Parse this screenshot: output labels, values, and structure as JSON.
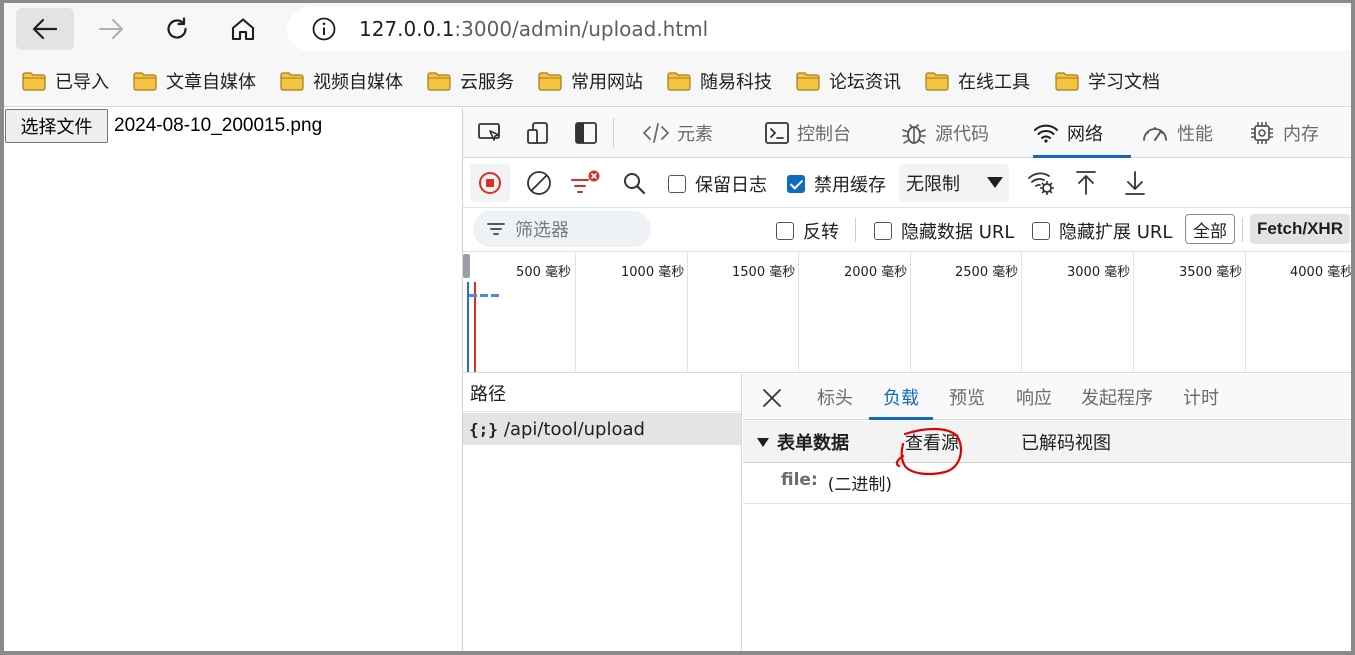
{
  "browser": {
    "address": {
      "host": "127.0.0.1",
      "rest": ":3000/admin/upload.html"
    },
    "bookmarks": [
      "已导入",
      "文章自媒体",
      "视频自媒体",
      "云服务",
      "常用网站",
      "随易科技",
      "论坛资讯",
      "在线工具",
      "学习文档"
    ]
  },
  "page": {
    "file_button_label": "选择文件",
    "file_name": "2024-08-10_200015.png"
  },
  "devtools": {
    "tabs": [
      "元素",
      "控制台",
      "源代码",
      "网络",
      "性能",
      "内存"
    ],
    "active_tab": "网络",
    "toolbar": {
      "preserve_log_label": "保留日志",
      "preserve_log_checked": false,
      "disable_cache_label": "禁用缓存",
      "disable_cache_checked": true,
      "throttle_value": "无限制"
    },
    "filter": {
      "placeholder": "筛选器",
      "invert_label": "反转",
      "hide_data_url_label": "隐藏数据 URL",
      "hide_ext_url_label": "隐藏扩展 URL",
      "all_label": "全部",
      "fetch_xhr_label": "Fetch/XHR"
    },
    "timeline_labels": [
      "500 毫秒",
      "1000 毫秒",
      "1500 毫秒",
      "2000 毫秒",
      "2500 毫秒",
      "3000 毫秒",
      "3500 毫秒",
      "4000 毫秒"
    ],
    "requests": {
      "column_header": "路径",
      "rows": [
        {
          "icon": "{;}",
          "path": "/api/tool/upload"
        }
      ]
    },
    "detail": {
      "tabs": [
        "标头",
        "负载",
        "预览",
        "响应",
        "发起程序",
        "计时"
      ],
      "active_tab": "负载",
      "section_title": "表单数据",
      "view_source": "查看源",
      "view_decoded": "已解码视图",
      "field_key": "file:",
      "field_value": "(二进制)"
    }
  },
  "colors": {
    "accent": "#0f6cbd",
    "record_red": "#d93025",
    "annotation": "#e00000",
    "folder": "#f4c542"
  }
}
